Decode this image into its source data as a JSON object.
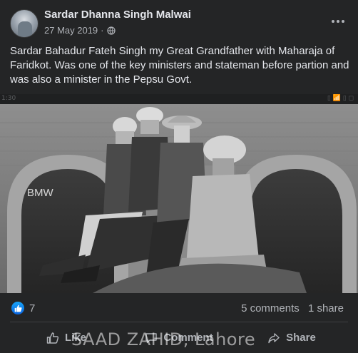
{
  "post": {
    "author": "Sardar Dhanna Singh Malwai",
    "date": "27 May 2019",
    "separator": "·",
    "privacy_icon": "globe-icon",
    "more_icon": "more-horizontal-icon",
    "text": "Sardar Bahadur Fateh Singh my Great Grandfather with Maharaja of Faridkot. Was one of the key ministers and stateman before partion and was also a minister in the Pepsu Govt."
  },
  "photo": {
    "top_strip_left": "1:30",
    "top_strip_right": "▯ 📶 ▯ ◻",
    "watermark": "BMW",
    "description_icon": "black-and-white-photograph"
  },
  "stats": {
    "reaction_icon": "like-reaction-icon",
    "reaction_count": "7",
    "comments": "5 comments",
    "shares": "1 share"
  },
  "actions": {
    "like_label": "Like",
    "comment_label": "Comment",
    "share_label": "Share"
  },
  "overlay_text": "SAAD ZAHID, Lahore",
  "colors": {
    "background": "#242526",
    "text_primary": "#e4e6eb",
    "text_secondary": "#b0b3b8",
    "like_blue": "#1877f2",
    "divider": "#3e4042"
  }
}
